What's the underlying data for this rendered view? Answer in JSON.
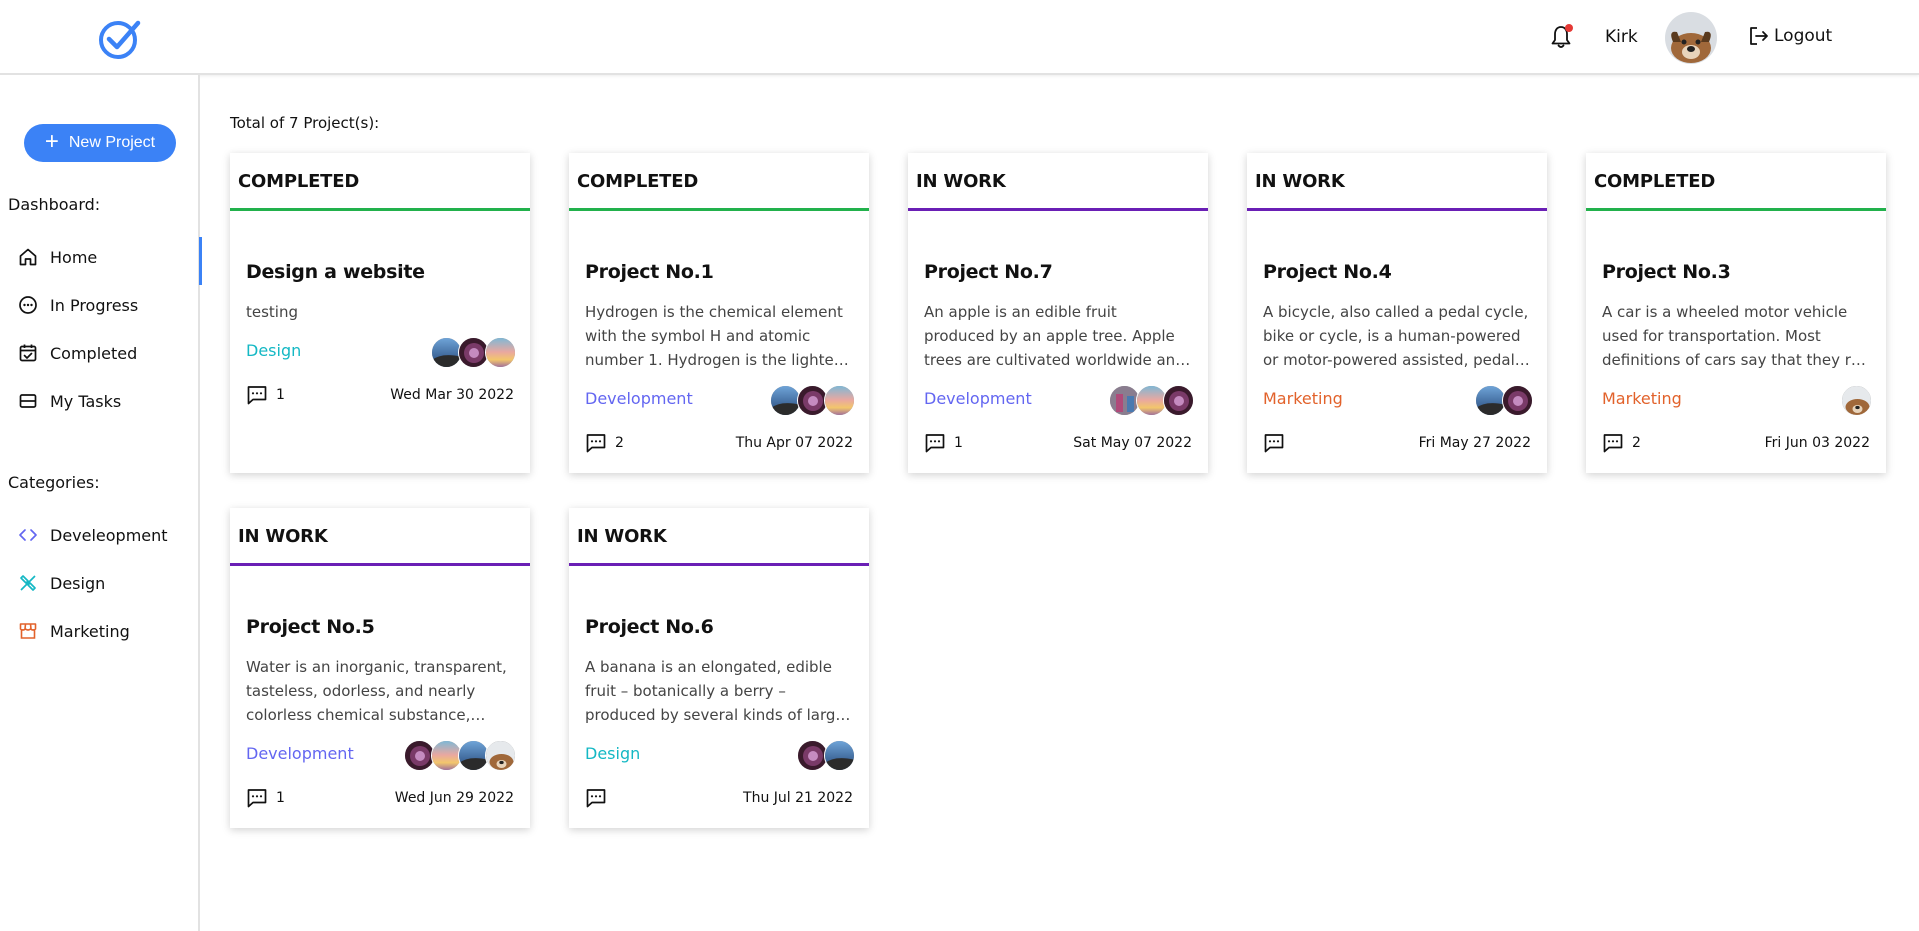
{
  "header": {
    "user_name": "Kirk",
    "logout_label": "Logout",
    "has_notification": true,
    "icons": {
      "logo": "check-circle-icon",
      "bell": "bell-icon",
      "logout": "logout-icon"
    }
  },
  "sidebar": {
    "new_project_label": "New Project",
    "dashboard_label": "Dashboard:",
    "categories_label": "Categories:",
    "dashboard_items": [
      {
        "label": "Home",
        "icon": "home-icon",
        "active": true
      },
      {
        "label": "In Progress",
        "icon": "ellipsis-circle-icon"
      },
      {
        "label": "Completed",
        "icon": "calendar-check-icon"
      },
      {
        "label": "My Tasks",
        "icon": "tasks-icon"
      }
    ],
    "category_items": [
      {
        "label": "Develeopment",
        "icon": "code-icon",
        "color": "#6366f1"
      },
      {
        "label": "Design",
        "icon": "design-tools-icon",
        "color": "#14b8c4"
      },
      {
        "label": "Marketing",
        "icon": "store-icon",
        "color": "#e2622b"
      }
    ]
  },
  "main": {
    "total_label": "Total of 7 Project(s):",
    "projects": [
      {
        "status": "COMPLETED",
        "title": "Design a website",
        "description": "testing",
        "category": "Design",
        "avatars": [
          "blue-sky",
          "purple-night",
          "sunset"
        ],
        "comments": "1",
        "date": "Wed Mar 30 2022"
      },
      {
        "status": "COMPLETED",
        "title": "Project No.1",
        "description": "Hydrogen is the chemical element with the symbol H and atomic number 1. Hydrogen is the lightest element.",
        "category": "Development",
        "avatars": [
          "blue-sky",
          "purple-night",
          "sunset"
        ],
        "comments": "2",
        "date": "Thu Apr 07 2022"
      },
      {
        "status": "IN WORK",
        "title": "Project No.7",
        "description": "An apple is an edible fruit produced by an apple tree. Apple trees are cultivated worldwide and are the most widely grown species.",
        "category": "Development",
        "avatars": [
          "people",
          "sunset",
          "purple-night"
        ],
        "comments": "1",
        "date": "Sat May 07 2022"
      },
      {
        "status": "IN WORK",
        "title": "Project No.4",
        "description": "A bicycle, also called a pedal cycle, bike or cycle, is a human-powered or motor-powered assisted, pedal-driven vehicle.",
        "category": "Marketing",
        "avatars": [
          "blue-sky",
          "purple-night"
        ],
        "comments": "",
        "date": "Fri May 27 2022"
      },
      {
        "status": "COMPLETED",
        "title": "Project No.3",
        "description": "A car is a wheeled motor vehicle used for transportation. Most definitions of cars say that they run primarily on roads.",
        "category": "Marketing",
        "avatars": [
          "dog"
        ],
        "comments": "2",
        "date": "Fri Jun 03 2022"
      },
      {
        "status": "IN WORK",
        "title": "Project No.5",
        "description": "Water is an inorganic, transparent, tasteless, odorless, and nearly colorless chemical substance, which is the main constituent.",
        "category": "Development",
        "avatars": [
          "purple-night",
          "sunset",
          "blue-sky",
          "dog"
        ],
        "comments": "1",
        "date": "Wed Jun 29 2022"
      },
      {
        "status": "IN WORK",
        "title": "Project No.6",
        "description": "A banana is an elongated, edible fruit – botanically a berry – produced by several kinds of large herbaceous plants.",
        "category": "Design",
        "avatars": [
          "purple-night",
          "blue-sky"
        ],
        "comments": "",
        "date": "Thu Jul 21 2022"
      }
    ]
  },
  "colors": {
    "accent": "#3b82f6",
    "completed": "#22b14c",
    "in_work": "#6a1fb5",
    "development": "#6366f1",
    "design": "#14b8c4",
    "marketing": "#e2622b"
  }
}
